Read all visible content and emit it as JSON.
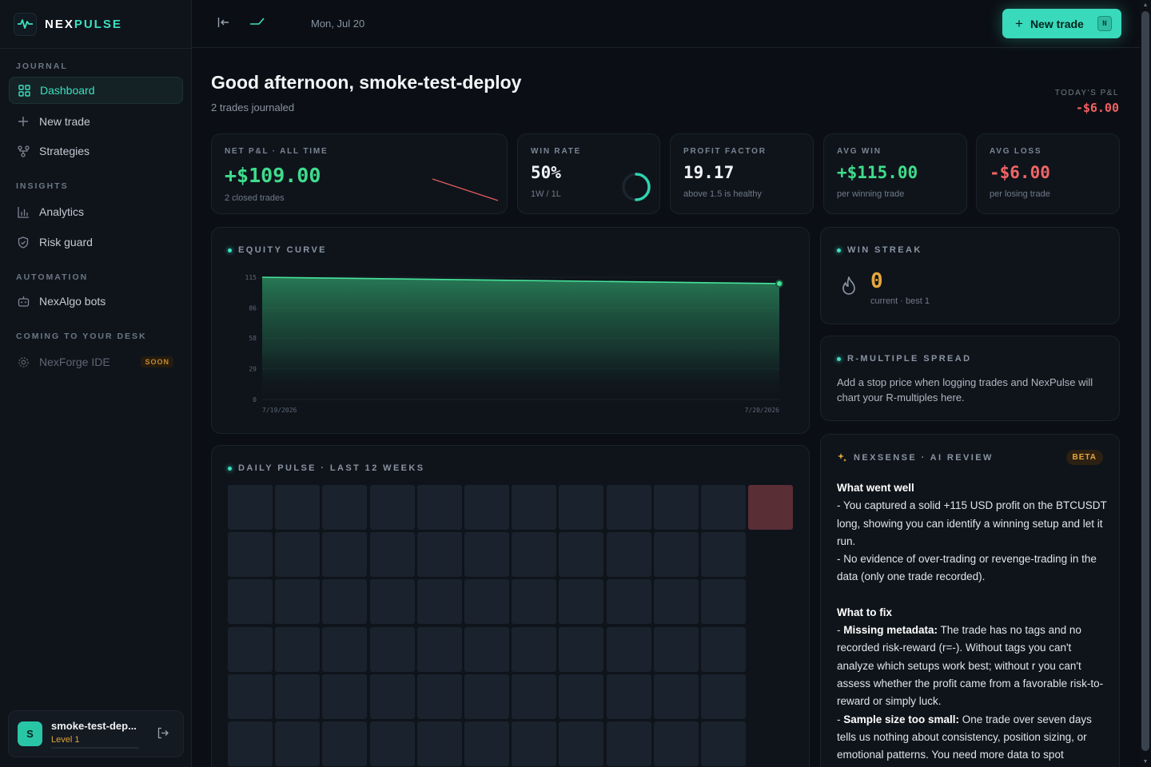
{
  "brand": {
    "part1": "NEX",
    "part2": "PULSE"
  },
  "sidebar": {
    "sections": {
      "journal": "JOURNAL",
      "insights": "INSIGHTS",
      "automation": "AUTOMATION",
      "coming": "COMING TO YOUR DESK"
    },
    "items": [
      {
        "label": "Dashboard",
        "icon": "dashboard-icon"
      },
      {
        "label": "New trade",
        "icon": "plus-icon"
      },
      {
        "label": "Strategies",
        "icon": "strategies-icon"
      },
      {
        "label": "Analytics",
        "icon": "bar-chart-icon"
      },
      {
        "label": "Risk guard",
        "icon": "shield-icon"
      },
      {
        "label": "NexAlgo bots",
        "icon": "bot-icon"
      },
      {
        "label": "NexForge IDE",
        "icon": "gear-icon"
      }
    ],
    "soon_badge": "SOON",
    "user": {
      "initial": "S",
      "name": "smoke-test-dep...",
      "level": "Level 1"
    }
  },
  "topbar": {
    "date": "Mon, Jul 20",
    "new_trade_label": "New trade",
    "new_trade_shortcut": "N"
  },
  "header": {
    "greeting": "Good afternoon, smoke-test-deploy",
    "subtitle": "2 trades journaled",
    "today_label": "TODAY'S P&L",
    "today_value": "-$6.00"
  },
  "kpis": [
    {
      "label": "NET P&L · ALL TIME",
      "value": "+$109.00",
      "sub": "2 closed trades"
    },
    {
      "label": "WIN RATE",
      "value": "50%",
      "sub": "1W / 1L",
      "fraction": 0.5
    },
    {
      "label": "PROFIT FACTOR",
      "value": "19.17",
      "sub": "above 1.5 is healthy"
    },
    {
      "label": "AVG WIN",
      "value": "+$115.00",
      "sub": "per winning trade"
    },
    {
      "label": "AVG LOSS",
      "value": "-$6.00",
      "sub": "per losing trade"
    }
  ],
  "equity": {
    "title": "EQUITY CURVE",
    "yticks": [
      "115",
      "86",
      "58",
      "29",
      "0"
    ],
    "xticks": [
      "7/19/2026",
      "7/20/2026"
    ]
  },
  "chart_data": {
    "type": "area",
    "x": [
      "7/19/2026",
      "7/20/2026"
    ],
    "series": [
      {
        "values": [
          115,
          109
        ]
      }
    ],
    "ylim": [
      0,
      115
    ]
  },
  "streak": {
    "title": "WIN STREAK",
    "value": "0",
    "sub": "current · best 1"
  },
  "rmultiple": {
    "title": "R-MULTIPLE SPREAD",
    "text": "Add a stop price when logging trades and NexPulse will chart your R-multiples here."
  },
  "daily": {
    "title": "DAILY PULSE · LAST 12 WEEKS",
    "loss_color": "#5a2e35",
    "empty_color": "#1a222d"
  },
  "ai": {
    "title": "NEXSENSE · AI REVIEW",
    "badge": "BETA",
    "went_well_h": "What went well",
    "went_well_1": "- You captured a solid +115 USD profit on the BTCUSDT long, showing you can identify a winning setup and let it run.",
    "went_well_2": "- No evidence of over-trading or revenge-trading in the data (only one trade recorded).",
    "fix_h": "What to fix",
    "fix_1_b": "Missing metadata:",
    "fix_1": " The trade has no tags and no recorded risk-reward (r=-). Without tags you can't analyze which setups work best; without r you can't assess whether the profit came from a favorable risk-to-reward or simply luck.",
    "fix_2_b": "Sample size too small:",
    "fix_2": " One trade over seven days tells us nothing about consistency, position sizing, or emotional patterns. You need more data to spot"
  },
  "colors": {
    "accent": "#3de0c1",
    "profit": "#3fdc8c",
    "loss": "#f06565",
    "warn": "#e6a63a"
  }
}
